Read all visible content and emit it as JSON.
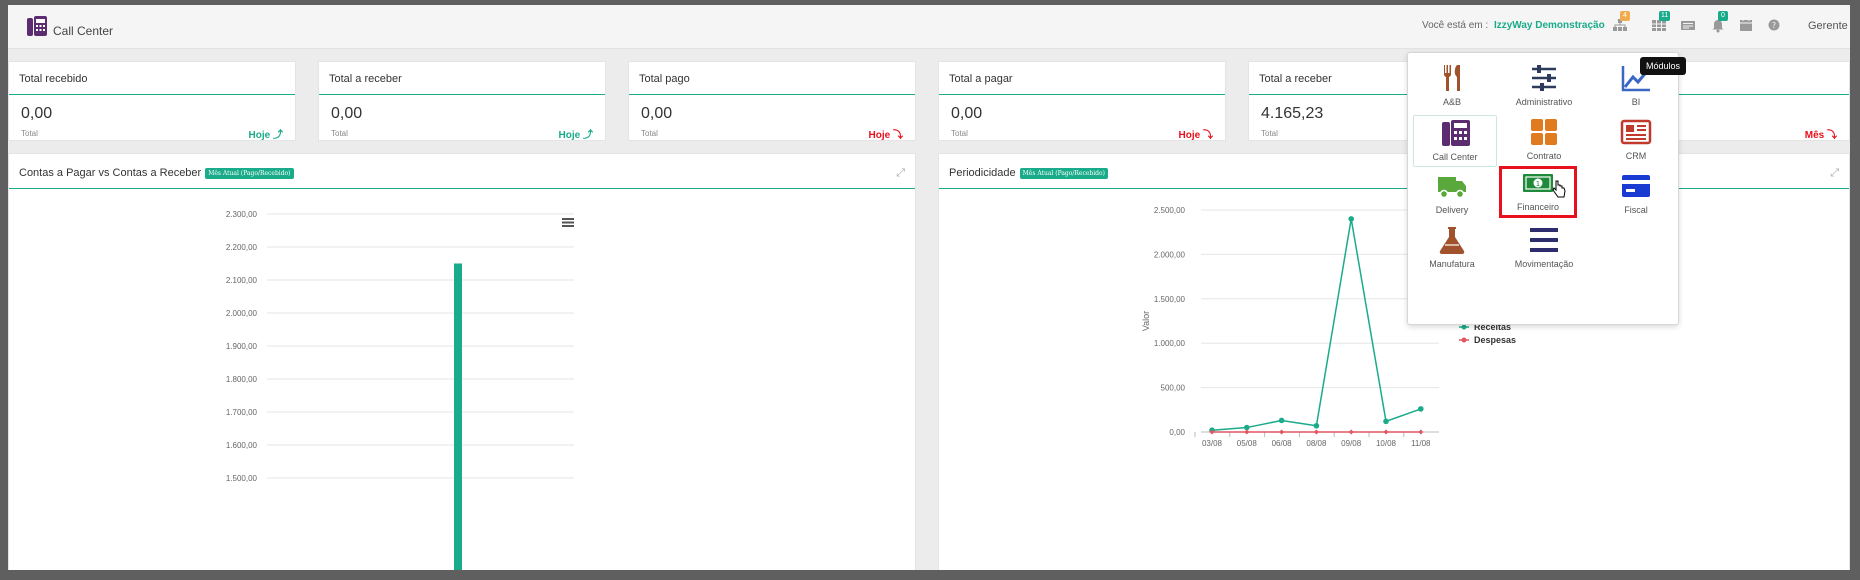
{
  "header": {
    "app_title": "Call Center",
    "breadcrumb_prefix": "Você está em :",
    "breadcrumb_company": "IzzyWay Demonstração",
    "badges": [
      "4",
      "11",
      "0"
    ],
    "user": "Gerente"
  },
  "cards": [
    {
      "title": "Total recebido",
      "value": "0,00",
      "sub": "Total",
      "link": "Hoje ⤴",
      "color": "#1aab8a"
    },
    {
      "title": "Total a receber",
      "value": "0,00",
      "sub": "Total",
      "link": "Hoje ⤴",
      "color": "#1aab8a"
    },
    {
      "title": "Total pago",
      "value": "0,00",
      "sub": "Total",
      "link": "Hoje ⤵",
      "color": "#e8101d"
    },
    {
      "title": "Total a pagar",
      "value": "0,00",
      "sub": "Total",
      "link": "Hoje ⤵",
      "color": "#e8101d"
    },
    {
      "title": "Total a receber",
      "value": "4.165,23",
      "sub": "Total",
      "link": "",
      "color": "#1aab8a"
    },
    {
      "title": "",
      "value": "",
      "sub": "",
      "link": "Mês ⤵",
      "color": "#e8101d"
    }
  ],
  "panels": {
    "left": {
      "title": "Contas a Pagar vs Contas a Receber",
      "pill": "Mês Atual (Pago/Recebido)"
    },
    "right": {
      "title": "Periodicidade",
      "pill": "Mês Atual (Pago/Recebido)"
    }
  },
  "modules_tooltip": "Módulos",
  "modules": [
    {
      "label": "A&B",
      "icon": "fork-knife-icon",
      "color": "#a0522d"
    },
    {
      "label": "Administrativo",
      "icon": "sliders-icon",
      "color": "#2d3a5c"
    },
    {
      "label": "BI",
      "icon": "trend-line-icon",
      "color": "#3a66c4"
    },
    {
      "label": "Call Center",
      "icon": "phone-icon",
      "color": "#5b2c6f"
    },
    {
      "label": "Contrato",
      "icon": "grid-icon",
      "color": "#e07b1f"
    },
    {
      "label": "CRM",
      "icon": "newspaper-icon",
      "color": "#c0392b"
    },
    {
      "label": "Delivery",
      "icon": "truck-icon",
      "color": "#5aa83c"
    },
    {
      "label": "Financeiro",
      "icon": "money-icon",
      "color": "#1e8a3a"
    },
    {
      "label": "Fiscal",
      "icon": "credit-card-icon",
      "color": "#1a3bd1"
    },
    {
      "label": "Manufatura",
      "icon": "flask-icon",
      "color": "#a0522d"
    },
    {
      "label": "Movimentação",
      "icon": "list-icon",
      "color": "#2d2d6e"
    }
  ],
  "chart_data": [
    {
      "type": "bar",
      "ylim": [
        1500,
        2300
      ],
      "yticks": [
        "2.300,00",
        "2.200,00",
        "2.100,00",
        "2.000,00",
        "1.900,00",
        "1.800,00",
        "1.700,00",
        "1.600,00",
        "1.500,00"
      ],
      "series": [
        {
          "values": [
            2150
          ],
          "color": "#1aab8a"
        }
      ]
    },
    {
      "type": "line",
      "ylabel": "Valor",
      "ylim": [
        0,
        2500
      ],
      "yticks": [
        "2.500,00",
        "2.000,00",
        "1.500,00",
        "1.000,00",
        "500,00",
        "0,00"
      ],
      "categories": [
        "03/08",
        "05/08",
        "06/08",
        "08/08",
        "09/08",
        "10/08",
        "11/08"
      ],
      "legend_position": "right",
      "series": [
        {
          "name": "Receitas",
          "color": "#1aab8a",
          "values": [
            20,
            50,
            130,
            70,
            2400,
            120,
            260
          ]
        },
        {
          "name": "Despesas",
          "color": "#e25563",
          "values": [
            0,
            0,
            0,
            0,
            0,
            0,
            0
          ]
        }
      ]
    }
  ]
}
